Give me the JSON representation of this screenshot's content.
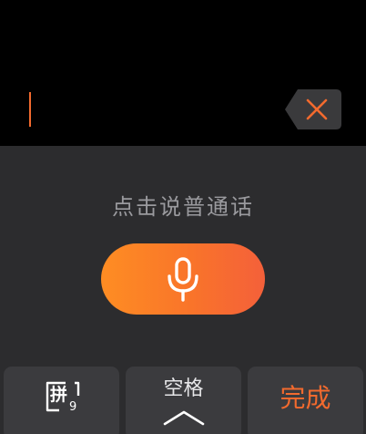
{
  "input": {
    "caret_color": "#f26a2e"
  },
  "delete_key": {
    "icon": "backspace-icon",
    "icon_color": "#f26a2e"
  },
  "voice": {
    "hint": "点击说普通话",
    "mic_icon": "microphone-icon",
    "gradient_start": "#fe8d23",
    "gradient_end": "#f4603a"
  },
  "bottom_keys": {
    "pinyin": {
      "glyph": "拼",
      "number": "9",
      "icon": "pinyin-9-keyboard-icon"
    },
    "space": {
      "label": "空格",
      "icon": "chevron-up-icon"
    },
    "done": {
      "label": "完成",
      "color": "#f26a2e"
    }
  }
}
